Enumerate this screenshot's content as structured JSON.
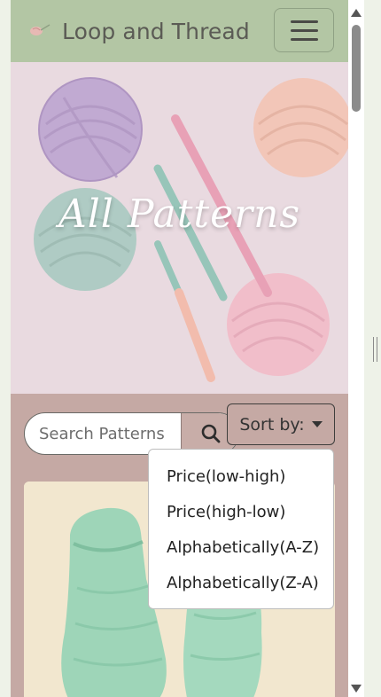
{
  "navbar": {
    "brand_name": "Loop and Thread",
    "brand_logo_icon": "yarn-logo-icon",
    "menu_icon": "hamburger-menu-icon"
  },
  "hero": {
    "title": "All Patterns"
  },
  "search": {
    "placeholder": "Search Patterns",
    "value": "",
    "button_icon": "search-icon"
  },
  "sort": {
    "label": "Sort by:",
    "icon": "caret-down-icon",
    "options": [
      "Price(low-high)",
      "Price(high-low)",
      "Alphabetically(A-Z)",
      "Alphabetically(Z-A)"
    ]
  },
  "products": [
    {
      "image_icon": "crochet-baby-booties-image"
    }
  ],
  "colors": {
    "navbar": "#b3c6a4",
    "page_background": "#c5a9a4",
    "hero_background": "#e9d9df"
  }
}
